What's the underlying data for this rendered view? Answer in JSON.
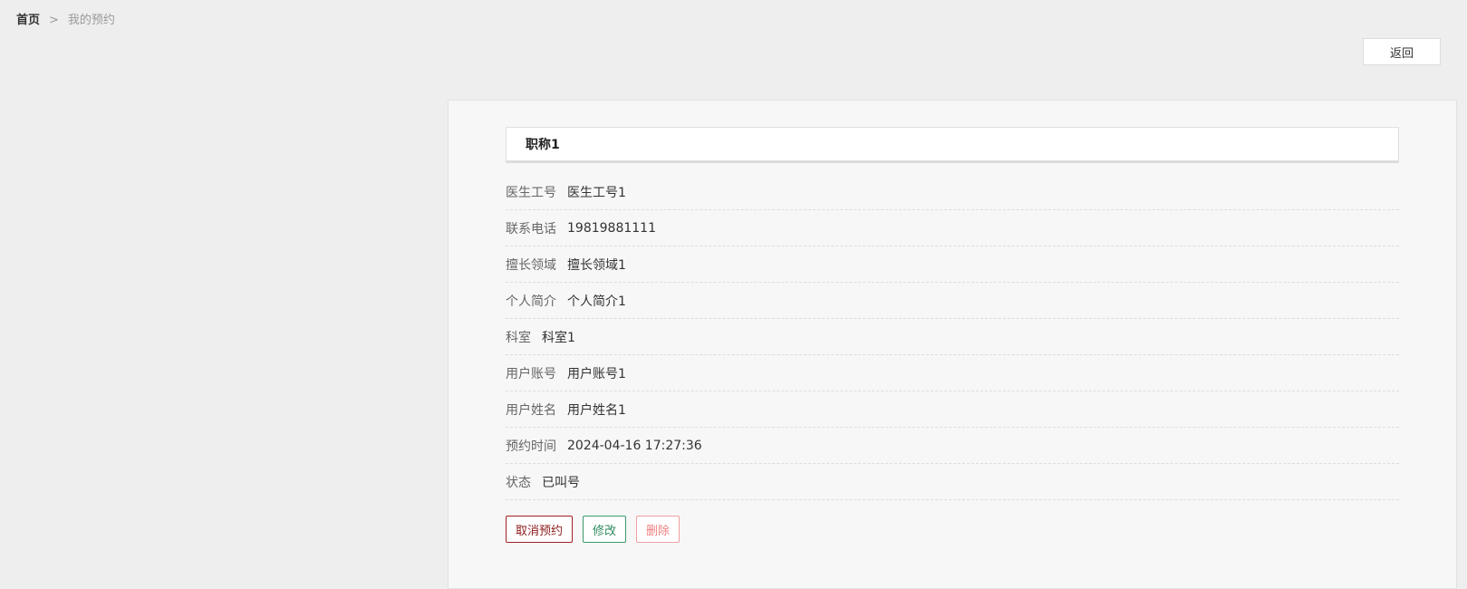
{
  "breadcrumb": {
    "home": "首页",
    "separator": ">",
    "current": "我的预约"
  },
  "toolbar": {
    "back_label": "返回"
  },
  "detail": {
    "title": "职称1",
    "fields": [
      {
        "label": "医生工号",
        "value": "医生工号1"
      },
      {
        "label": "联系电话",
        "value": "19819881111"
      },
      {
        "label": "擅长领域",
        "value": "擅长领域1"
      },
      {
        "label": "个人简介",
        "value": "个人简介1"
      },
      {
        "label": "科室",
        "value": "科室1"
      },
      {
        "label": "用户账号",
        "value": "用户账号1"
      },
      {
        "label": "用户姓名",
        "value": "用户姓名1"
      },
      {
        "label": "预约时间",
        "value": "2024-04-16 17:27:36"
      },
      {
        "label": "状态",
        "value": "已叫号"
      }
    ]
  },
  "actions": {
    "cancel_label": "取消预约",
    "edit_label": "修改",
    "delete_label": "删除"
  },
  "colors": {
    "page_bg": "#eeeeee",
    "panel_bg": "#f7f7f7",
    "cancel": "#8b1a1a",
    "edit": "#2f8a5e",
    "delete": "#f08080"
  }
}
